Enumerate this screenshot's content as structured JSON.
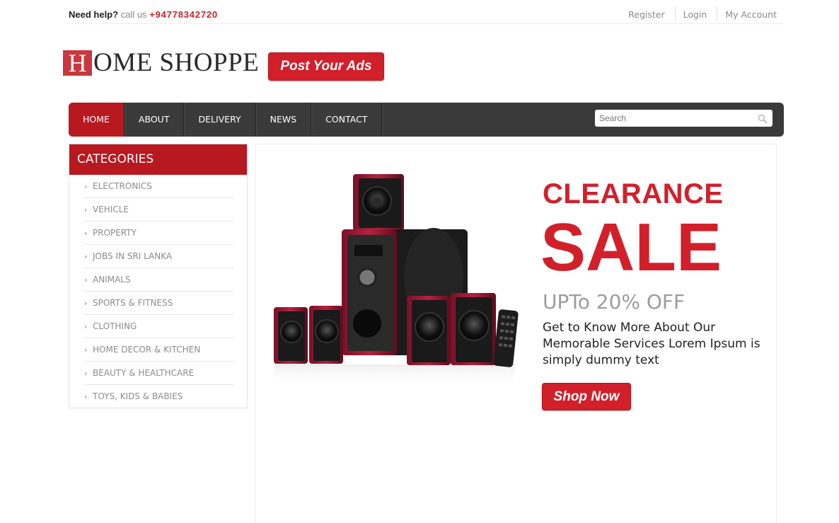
{
  "topbar": {
    "help_label": "Need help?",
    "call_label": "call us",
    "phone": "+94778342720",
    "links": [
      "Register",
      "Login",
      "My Account"
    ]
  },
  "logo": {
    "initial": "H",
    "rest": "OME SHOPPE"
  },
  "post_ads_label": "Post Your Ads",
  "nav": {
    "items": [
      "HOME",
      "ABOUT",
      "DELIVERY",
      "NEWS",
      "CONTACT"
    ],
    "active": "HOME",
    "search_placeholder": "Search"
  },
  "sidebar": {
    "title": "CATEGORIES",
    "items": [
      "ELECTRONICS",
      "VEHICLE",
      "PROPERTY",
      "JOBS IN SRI LANKA",
      "ANIMALS",
      "SPORTS & FITNESS",
      "CLOTHING",
      "HOME DECOR & KITCHEN",
      "BEAUTY & HEALTHCARE",
      "TOYS, KIDS & BABIES"
    ]
  },
  "banner": {
    "headline": "CLEARANCE",
    "big": "SALE",
    "offer": "UPTo 20% OFF",
    "description": "Get to Know More About Our Memorable Services Lorem Ipsum is simply dummy text",
    "button_label": "Shop Now"
  },
  "colors": {
    "brand_red": "#d2202b",
    "nav_dark": "#3a3a3a",
    "active_red": "#b8181f"
  }
}
